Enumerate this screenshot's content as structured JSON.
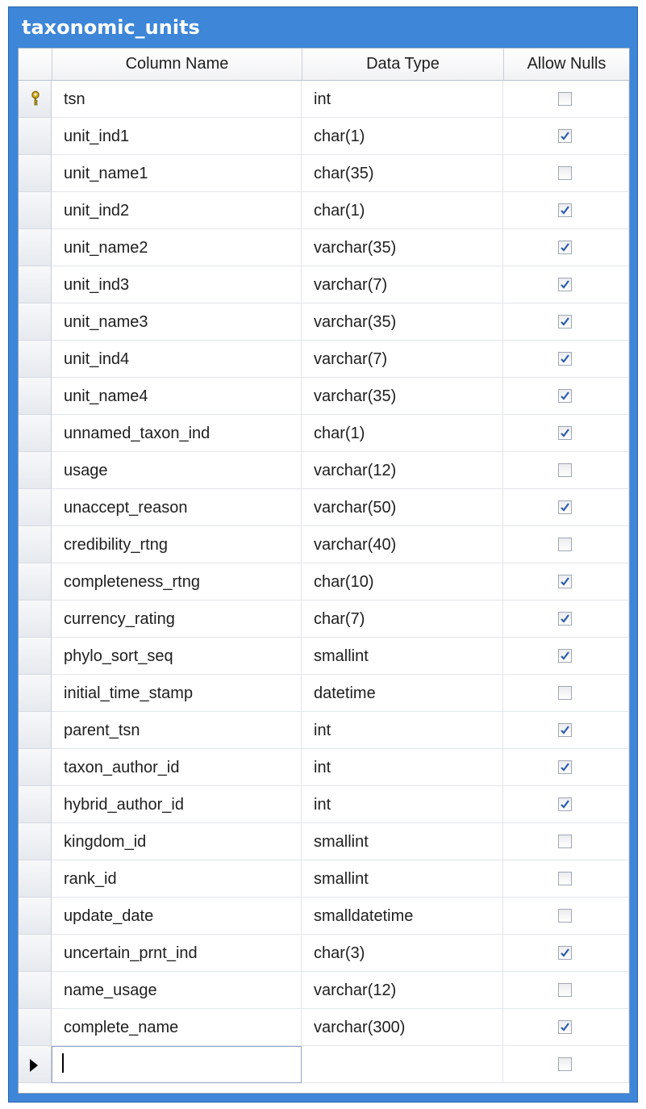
{
  "window": {
    "title": "taxonomic_units"
  },
  "columns": {
    "name": "Column Name",
    "type": "Data Type",
    "nulls": "Allow Nulls"
  },
  "colors": {
    "title_bar": "#3d86d8",
    "title_text": "#ffffff",
    "key_icon": "#d4a817",
    "check_mark": "#2a5db0"
  },
  "rows": [
    {
      "name": "tsn",
      "type": "int",
      "allow_nulls": false,
      "primary_key": true
    },
    {
      "name": "unit_ind1",
      "type": "char(1)",
      "allow_nulls": true
    },
    {
      "name": "unit_name1",
      "type": "char(35)",
      "allow_nulls": false
    },
    {
      "name": "unit_ind2",
      "type": "char(1)",
      "allow_nulls": true
    },
    {
      "name": "unit_name2",
      "type": "varchar(35)",
      "allow_nulls": true
    },
    {
      "name": "unit_ind3",
      "type": "varchar(7)",
      "allow_nulls": true
    },
    {
      "name": "unit_name3",
      "type": "varchar(35)",
      "allow_nulls": true
    },
    {
      "name": "unit_ind4",
      "type": "varchar(7)",
      "allow_nulls": true
    },
    {
      "name": "unit_name4",
      "type": "varchar(35)",
      "allow_nulls": true
    },
    {
      "name": "unnamed_taxon_ind",
      "type": "char(1)",
      "allow_nulls": true
    },
    {
      "name": "usage",
      "type": "varchar(12)",
      "allow_nulls": false
    },
    {
      "name": "unaccept_reason",
      "type": "varchar(50)",
      "allow_nulls": true
    },
    {
      "name": "credibility_rtng",
      "type": "varchar(40)",
      "allow_nulls": false
    },
    {
      "name": "completeness_rtng",
      "type": "char(10)",
      "allow_nulls": true
    },
    {
      "name": "currency_rating",
      "type": "char(7)",
      "allow_nulls": true
    },
    {
      "name": "phylo_sort_seq",
      "type": "smallint",
      "allow_nulls": true
    },
    {
      "name": "initial_time_stamp",
      "type": "datetime",
      "allow_nulls": false
    },
    {
      "name": "parent_tsn",
      "type": "int",
      "allow_nulls": true
    },
    {
      "name": "taxon_author_id",
      "type": "int",
      "allow_nulls": true
    },
    {
      "name": "hybrid_author_id",
      "type": "int",
      "allow_nulls": true
    },
    {
      "name": "kingdom_id",
      "type": "smallint",
      "allow_nulls": false
    },
    {
      "name": "rank_id",
      "type": "smallint",
      "allow_nulls": false
    },
    {
      "name": "update_date",
      "type": "smalldatetime",
      "allow_nulls": false
    },
    {
      "name": "uncertain_prnt_ind",
      "type": "char(3)",
      "allow_nulls": true
    },
    {
      "name": "name_usage",
      "type": "varchar(12)",
      "allow_nulls": false
    },
    {
      "name": "complete_name",
      "type": "varchar(300)",
      "allow_nulls": true
    }
  ],
  "new_row": {
    "name": "",
    "type": "",
    "allow_nulls": false,
    "current": true
  }
}
